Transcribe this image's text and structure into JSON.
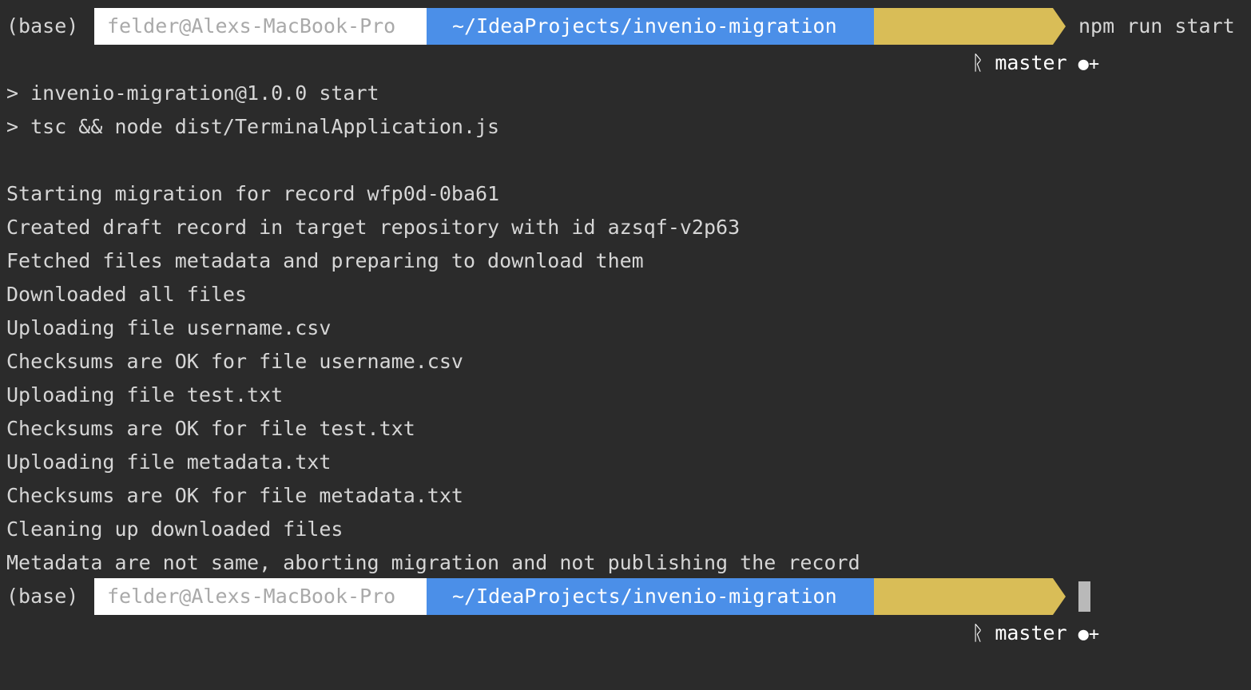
{
  "terminal": {
    "top_partial": "                                                                                                               ",
    "prompt1": {
      "env": "(base)",
      "user": "felder@Alexs-MacBook-Pro",
      "path": "~/IdeaProjects/invenio-migration",
      "branch": "master",
      "git_icon": "ᚱ",
      "dirty_icon": "●+",
      "command": "npm run start"
    },
    "output_lines": [
      "> invenio-migration@1.0.0 start",
      "> tsc && node dist/TerminalApplication.js",
      "",
      "Starting migration for record wfp0d-0ba61",
      "Created draft record in target repository with id azsqf-v2p63",
      "Fetched files metadata and preparing to download them",
      "Downloaded all files",
      "Uploading file username.csv",
      "Checksums are OK for file username.csv",
      "Uploading file test.txt",
      "Checksums are OK for file test.txt",
      "Uploading file metadata.txt",
      "Checksums are OK for file metadata.txt",
      "Cleaning up downloaded files",
      "Metadata are not same, aborting migration and not publishing the record"
    ],
    "prompt2": {
      "env": "(base)",
      "user": "felder@Alexs-MacBook-Pro",
      "path": "~/IdeaProjects/invenio-migration",
      "branch": "master",
      "git_icon": "ᚱ",
      "dirty_icon": "●+"
    },
    "colors": {
      "background": "#2b2b2b",
      "text": "#d6d6d6",
      "user_segment": "#ffffff",
      "path_segment": "#4b8fe8",
      "branch_segment": "#d9bd57",
      "cursor": "#b9b9b9"
    }
  }
}
